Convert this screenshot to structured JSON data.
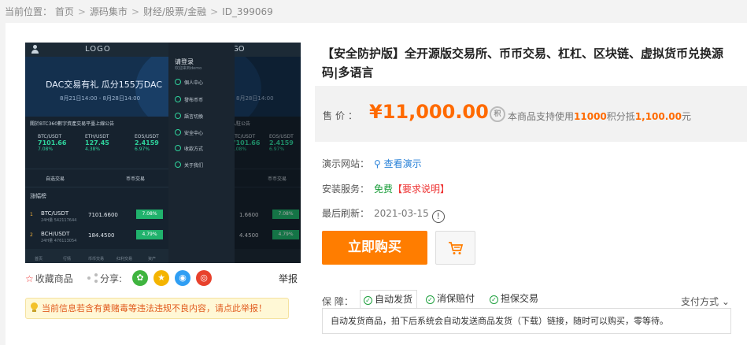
{
  "breadcrumb": {
    "prefix": "当前位置：",
    "items": [
      "首页",
      "源码集市",
      "财经/股票/金融",
      "ID_399069"
    ],
    "sep": ">"
  },
  "shot": {
    "logo": "LOGO",
    "logo_right": "GO",
    "banner_title": "DAC交易有礼 瓜分155万DAC",
    "banner_date": "8月21日14:00 - 8月28日14:00",
    "banner_date_right": "8月28日14:00",
    "notice": "關於BTC360數字資產交易平臺上線公告",
    "notice_right": "入駐公告",
    "tickers": [
      {
        "pair": "BTC/USDT",
        "price": "7101.66",
        "change": "7.08%"
      },
      {
        "pair": "ETH/USDT",
        "price": "127.45",
        "change": "4.38%"
      },
      {
        "pair": "EOS/USDT",
        "price": "2.4159",
        "change": "6.97%"
      }
    ],
    "tab_left": "自选交易",
    "tab_right": "币币交易",
    "rank_title": "涨幅榜",
    "rows": [
      {
        "num": "1",
        "pair": "BTC/USDT",
        "sub": "24H量 542117644",
        "price": "7101.6600",
        "change": "7.08%",
        "price_right": "1.6600",
        "change_right": "7.08%"
      },
      {
        "num": "2",
        "pair": "BCH/USDT",
        "sub": "24H量 476113054",
        "price": "184.4500",
        "change": "4.79%",
        "price_right": "4.4500",
        "change_right": "4.79%"
      }
    ],
    "bottom_tabs": [
      "首页",
      "行情",
      "币币交易",
      "红利交易",
      "资产"
    ],
    "drawer": {
      "title": "请登录",
      "subtitle": "欢迎来到demo",
      "items": [
        "個人中心",
        "發布币币",
        "語言切換",
        "安全中心",
        "收款方式",
        "关于我们"
      ]
    }
  },
  "actions": {
    "favorite": "收藏商品",
    "share": "分享:",
    "share_buttons": [
      {
        "name": "wechat",
        "glyph": "✿",
        "color": "#3fb43f"
      },
      {
        "name": "favorite-star",
        "glyph": "★",
        "color": "#f4b400"
      },
      {
        "name": "qq",
        "glyph": "◉",
        "color": "#2f9ef3"
      },
      {
        "name": "weibo",
        "glyph": "◎",
        "color": "#e8412c"
      }
    ],
    "report": "举报"
  },
  "warning": "当前信息若含有黄赌毒等违法违规不良内容，请点此举报！",
  "product": {
    "title": "【安全防护版】全开源版交易所、币币交易、杠杠、区块链、虚拟货币兑换源码|多语言",
    "price_label": "售价：",
    "price": "¥11,000.00",
    "points_icon": "积",
    "points_text_1": "本商品支持使用",
    "points_amount": "11000",
    "points_text_2": "积分抵",
    "points_value": "1,100.00",
    "points_text_3": "元"
  },
  "fields": {
    "demo_label": "演示网站：",
    "demo_value": "查看演示",
    "install_label": "安装服务：",
    "install_value": "免费",
    "install_note": "【要求说明】",
    "refresh_label": "最后刷新：",
    "refresh_value": "2021-03-15",
    "info_icon": "!"
  },
  "buttons": {
    "buy": "立即购买"
  },
  "guarantee": {
    "label": "保 障：",
    "tags": [
      "自动发货",
      "消保赔付",
      "担保交易"
    ],
    "pay_method": "支付方式",
    "description": "自动发货商品，拍下后系统会自动发送商品发货（下载）链接，随时可以购买，零等待。"
  },
  "colors": {
    "accent": "#ff6a00",
    "buy_button": "#ff7d00",
    "link": "#2a82d8",
    "free": "#1a9e3a",
    "warning_text": "#e15b1e"
  }
}
